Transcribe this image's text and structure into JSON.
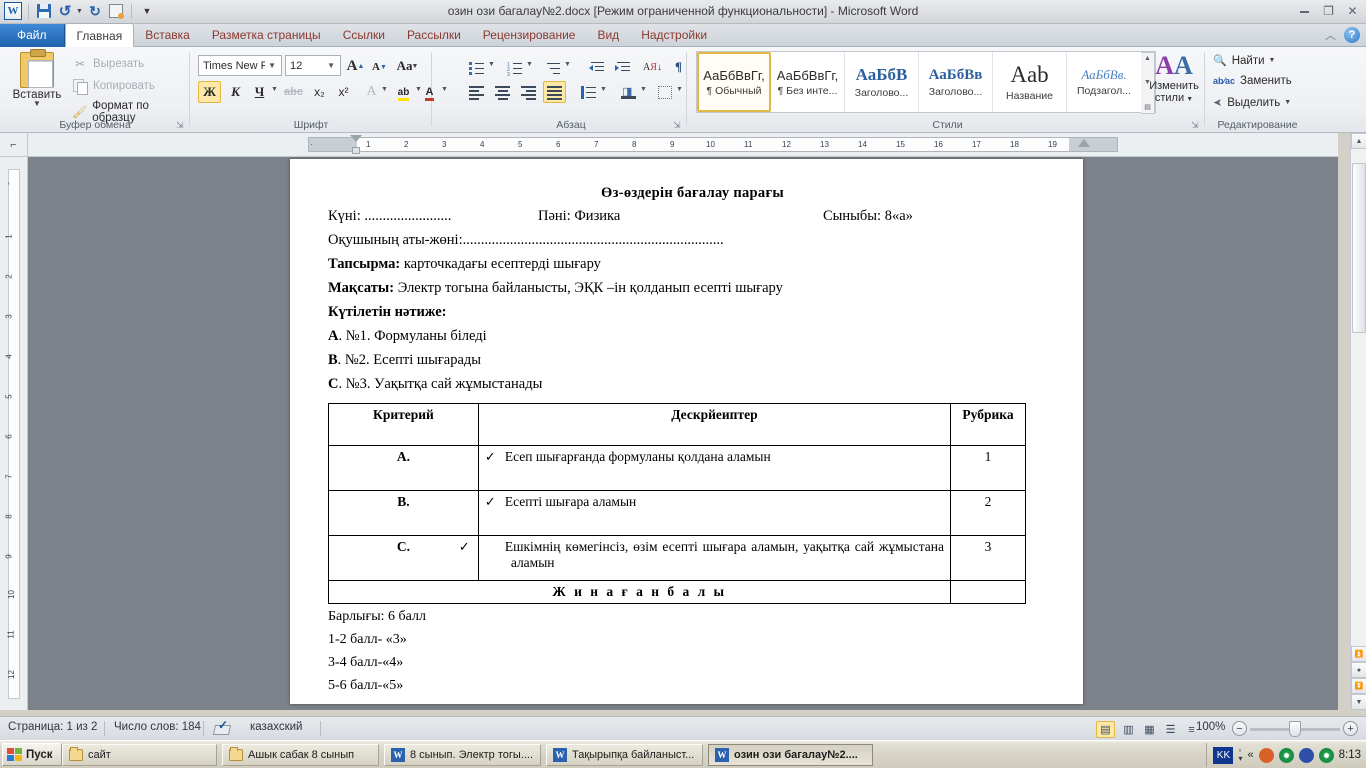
{
  "window": {
    "title": "озин ози багалау№2.docx [Режим ограниченной функциональности]  -  Microsoft Word",
    "app_logo": "W",
    "minimize": "minimize-icon",
    "restore": "restore-icon",
    "close": "close-icon"
  },
  "quick_access": {
    "save": "save-icon",
    "undo": "undo-icon",
    "redo": "redo-icon",
    "print_preview": "print-preview-icon",
    "customize": "customize-qat-icon"
  },
  "tabs": [
    {
      "label": "Файл",
      "id": "file"
    },
    {
      "label": "Главная",
      "id": "home"
    },
    {
      "label": "Вставка",
      "id": "insert"
    },
    {
      "label": "Разметка страницы",
      "id": "page-layout"
    },
    {
      "label": "Ссылки",
      "id": "references"
    },
    {
      "label": "Рассылки",
      "id": "mailings"
    },
    {
      "label": "Рецензирование",
      "id": "review"
    },
    {
      "label": "Вид",
      "id": "view"
    },
    {
      "label": "Надстройки",
      "id": "addins"
    }
  ],
  "ribbon": {
    "clipboard": {
      "group_label": "Буфер обмена",
      "paste": "Вставить",
      "cut": "Вырезать",
      "copy": "Копировать",
      "format_painter": "Формат по образцу"
    },
    "font": {
      "group_label": "Шрифт",
      "font_name": "Times New Rо",
      "font_size": "12",
      "grow_font": "А",
      "shrink_font": "А",
      "change_case": "Аа",
      "bold": "Ж",
      "italic": "К",
      "underline": "Ч",
      "strikethrough": "abc",
      "subscript": "x₂",
      "superscript": "x²",
      "text_effects": "A",
      "highlight": "ab",
      "font_color": "A"
    },
    "paragraph": {
      "group_label": "Абзац"
    },
    "styles": {
      "group_label": "Стили",
      "items": [
        {
          "preview": "АаБбВвГг,",
          "name": "¶ Обычный",
          "selected": true
        },
        {
          "preview": "АаБбВвГг,",
          "name": "¶ Без инте...",
          "selected": false
        },
        {
          "preview": "АаБбВ",
          "name": "Заголово...",
          "selected": false
        },
        {
          "preview": "АаБбВв",
          "name": "Заголово...",
          "selected": false
        },
        {
          "preview": "Aab",
          "name": "Название",
          "selected": false
        },
        {
          "preview": "АаБбВв.",
          "name": "Подзагол...",
          "selected": false
        }
      ],
      "change_styles_line1": "Изменить",
      "change_styles_line2": "стили"
    },
    "editing": {
      "group_label": "Редактирование",
      "find": "Найти",
      "replace": "Заменить",
      "select": "Выделить"
    }
  },
  "ruler": {
    "horizontal_ticks": [
      "1",
      "1",
      "2",
      "3",
      "4",
      "5",
      "6",
      "7",
      "8",
      "9",
      "10",
      "11",
      "12",
      "13",
      "14",
      "15",
      "16",
      "17",
      "18",
      "19"
    ],
    "vertical_ticks": [
      "-",
      "1",
      "2",
      "3",
      "4",
      "5",
      "6",
      "7",
      "8",
      "9",
      "10",
      "11",
      "12"
    ]
  },
  "document": {
    "title": "Өз-өздерін бағалау парағы",
    "line_date_label": "Күні:",
    "line_date_dots": "........................",
    "line_subject": "Пәні: Физика",
    "line_class": "Сыныбы: 8«а»",
    "line_student_label": "Оқушының аты-жөні:",
    "line_student_dots": "........................................................................",
    "task_label": "Тапсырма:",
    "task_text": "карточкадағы есептерді шығару",
    "goal_label": "Мақсаты:",
    "goal_text": "Электр тогына байланысты, ЭҚК –ін қолданып есепті шығару",
    "expected_label": "Күтілетін нәтиже:",
    "expected": [
      {
        "letter": "A",
        "text": ". №1.  Формуланы біледі"
      },
      {
        "letter": "B",
        "text": ". №2. Есепті шығарады"
      },
      {
        "letter": "C",
        "text": ". №3. Уақытқа сай жұмыстанады"
      }
    ],
    "table": {
      "headers": [
        "Критерий",
        "Дескрйеиптер",
        "Рубрика"
      ],
      "rows": [
        {
          "criterion": "A.",
          "descriptor": "Есеп шығарғанда формуланы қолдана аламын",
          "rubric": "1"
        },
        {
          "criterion": "B.",
          "descriptor": "Есепті шығара аламын",
          "rubric": "2"
        },
        {
          "criterion": "C.",
          "descriptor": "Ешкімнің көмегінсіз, өзім есепті шығара аламын, уақытқа сай жұмыстана аламын",
          "rubric": "3"
        }
      ],
      "total_label": "Ж и н а ғ а н   б а л ы",
      "total_value": "",
      "check_mark": "✓"
    },
    "footer_lines": [
      " Барлығы: 6 балл",
      "1-2 балл- «3»",
      "3-4 балл-«4»",
      "5-6 балл-«5»"
    ]
  },
  "status_bar": {
    "page": "Страница: 1 из 2",
    "words": "Число слов: 184",
    "language": "казахский",
    "proofing_icon": "spell-check-icon",
    "zoom_level": "100%",
    "view_buttons": [
      "print-layout-icon",
      "full-screen-reading-icon",
      "web-layout-icon",
      "outline-icon",
      "draft-icon"
    ],
    "zoom_out": "−",
    "zoom_in": "+"
  },
  "taskbar": {
    "start": "Пуск",
    "items": [
      {
        "label": "сайт",
        "icon": "folder-icon",
        "active": false
      },
      {
        "label": "Ашык сабак 8 сынып",
        "icon": "folder-icon",
        "active": false
      },
      {
        "label": "8 сынып. Электр тогы....",
        "icon": "word-icon",
        "active": false
      },
      {
        "label": "Тақырыпқа байланыст...",
        "icon": "word-icon",
        "active": false
      },
      {
        "label": "озин ози багалау№2....",
        "icon": "word-icon",
        "active": true
      }
    ],
    "language_indicator": "KK",
    "tray_expand": "«",
    "clock": "8:13"
  },
  "colors": {
    "accent_blue": "#2b62ae",
    "tab_text": "#8b3a2e",
    "selection_gold": "#e0b843",
    "doc_bg": "#7c8289"
  }
}
